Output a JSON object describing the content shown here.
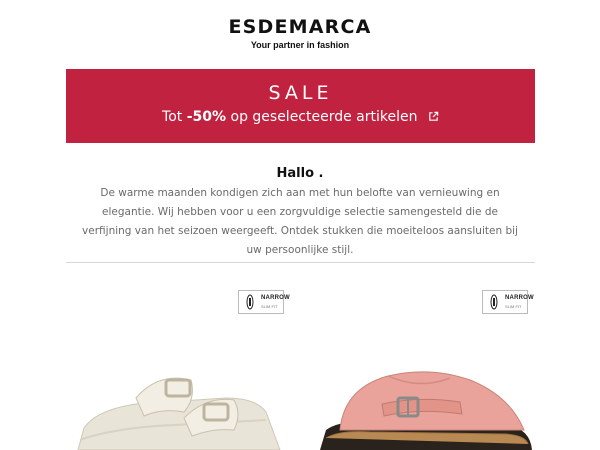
{
  "header": {
    "logo": "ESDEMARCA",
    "tagline": "Your partner in fashion"
  },
  "banner": {
    "title": "SALE",
    "subtitle_prefix": "Tot ",
    "subtitle_bold": "-50%",
    "subtitle_suffix": " op geselecteerde artikelen",
    "link_icon": "external-link-icon",
    "background_color": "#c0223f"
  },
  "greeting": {
    "title": "Hallo .",
    "body": "De warme maanden kondigen zich aan met hun belofte van vernieuwing en elegantie. Wij hebben voor u een zorgvuldige selectie samengesteld die de verfijning van het seizoen weergeeft. Ontdek stukken die moeiteloos aansluiten bij uw persoonlijke stijl."
  },
  "products": [
    {
      "badge_title": "NARROW",
      "badge_sub": "SLIM FIT",
      "image": "cream-sandal-image"
    },
    {
      "badge_title": "NARROW",
      "badge_sub": "SLIM FIT",
      "image": "pink-clog-image"
    }
  ]
}
